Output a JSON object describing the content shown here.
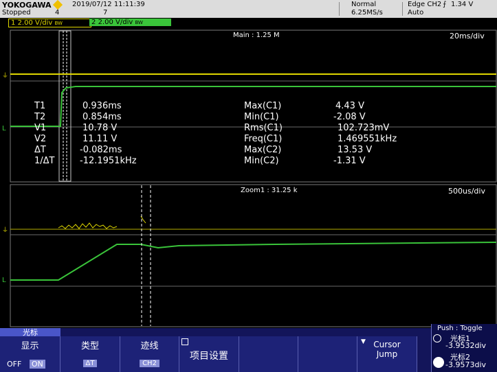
{
  "header": {
    "brand": "YOKOGAWA",
    "run_state": "Stopped",
    "digit_top": "4",
    "datetime": "2019/07/12 11:11:39",
    "acq_count": "7",
    "mode": "Normal",
    "sample_rate": "6.25MS/s",
    "trigger": "Edge CH2",
    "trigger_level": "1.34 V",
    "trigger_mode": "Auto"
  },
  "channels": {
    "ch1": {
      "num": "1",
      "scale": "2.00 V/div",
      "suffix": "BW",
      "color": "#e0d800"
    },
    "ch2": {
      "num": "2",
      "scale": "2.00 V/div",
      "suffix": "BW",
      "color": "#3ac43a"
    }
  },
  "main_window": {
    "label": "Main : 1.25 M",
    "timebase": "20ms/div",
    "measurements_left": [
      {
        "name": "T1",
        "value": "0.936ms"
      },
      {
        "name": "T2",
        "value": "0.854ms"
      },
      {
        "name": "V1",
        "value": "10.78 V"
      },
      {
        "name": "V2",
        "value": "11.11 V"
      },
      {
        "name": "ΔT",
        "value": "-0.082ms"
      },
      {
        "name": "1/ΔT",
        "value": "-12.1951kHz"
      }
    ],
    "measurements_right": [
      {
        "name": "Max(C1)",
        "value": "4.43 V"
      },
      {
        "name": "Min(C1)",
        "value": "-2.08 V"
      },
      {
        "name": "Rms(C1)",
        "value": "102.723mV"
      },
      {
        "name": "Freq(C1)",
        "value": "1.469551kHz"
      },
      {
        "name": "Max(C2)",
        "value": "13.53 V"
      },
      {
        "name": "Min(C2)",
        "value": "-1.31 V"
      }
    ]
  },
  "zoom_window": {
    "label": "Zoom1 : 31.25 k",
    "timebase": "500us/div"
  },
  "softkeys": {
    "tag": "光标",
    "display": {
      "title": "显示",
      "off": "OFF",
      "on": "ON"
    },
    "type": {
      "title": "类型",
      "value": "ΔT"
    },
    "trace": {
      "title": "迹线",
      "value": "CH2"
    },
    "items": {
      "title": "项目设置"
    },
    "blank": "",
    "cursor_jump": {
      "line1": "Cursor",
      "line2": "Jump"
    }
  },
  "cursor_panel": {
    "push_toggle": "Push : Toggle",
    "c1_label": "光标1",
    "c1_value": "-3.9532div",
    "c2_label": "光标2",
    "c2_value": "-3.9573div"
  }
}
